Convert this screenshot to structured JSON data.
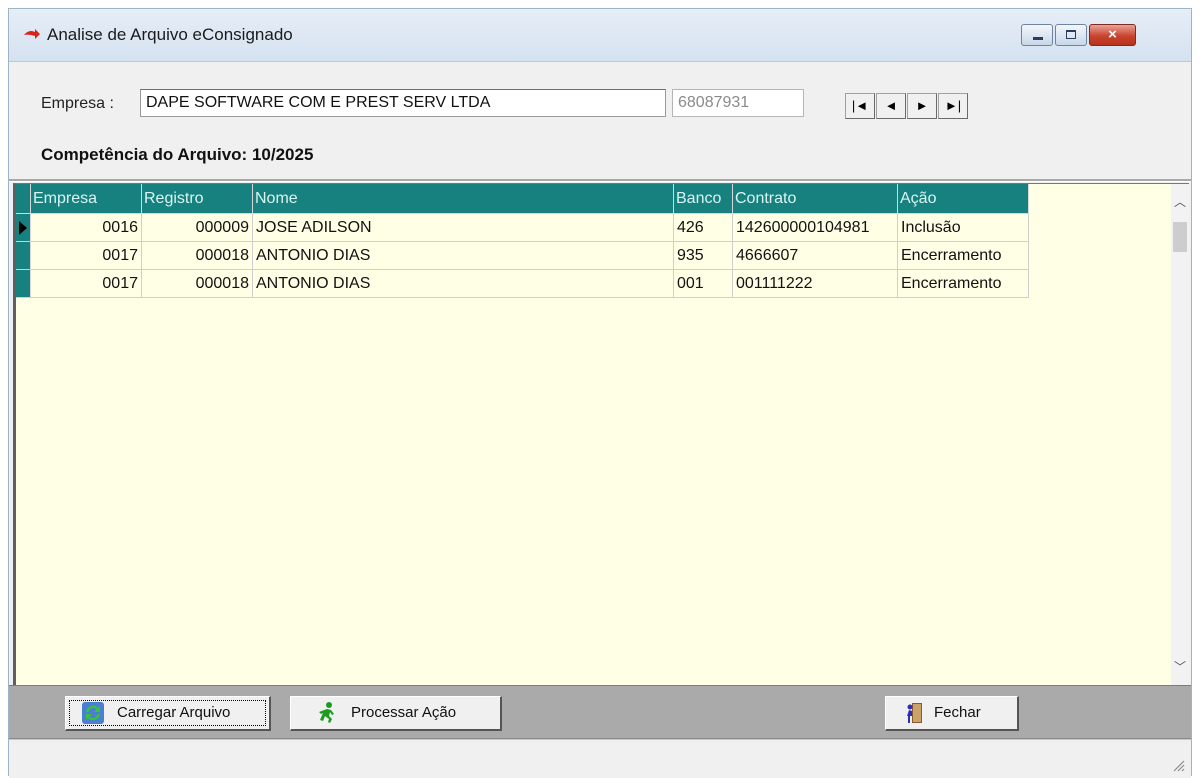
{
  "window": {
    "title": "Analise de Arquivo eConsignado",
    "close_glyph": "×"
  },
  "form": {
    "empresa_label": "Empresa :",
    "empresa_value": "DAPE SOFTWARE COM E PREST SERV LTDA",
    "lookup_button": "...",
    "empresa_code": "68087931",
    "nav_buttons": [
      "|◄",
      "◄",
      "►",
      "►|"
    ],
    "competencia_label": "Competência do Arquivo:",
    "competencia_value": "10/2025"
  },
  "grid": {
    "columns": [
      "Empresa",
      "Registro",
      "Nome",
      "Banco",
      "Contrato",
      "Ação"
    ],
    "rows": [
      [
        "0016",
        "000009",
        "JOSE ADILSON",
        "426",
        "142600000104981",
        "Inclusão"
      ],
      [
        "0017",
        "000018",
        "ANTONIO DIAS",
        "935",
        "4666607",
        "Encerramento"
      ],
      [
        "0017",
        "000018",
        "ANTONIO DIAS",
        "001",
        "001111222",
        "Encerramento"
      ]
    ],
    "current_row": 0,
    "colors": {
      "header_bg": "#17817f",
      "grid_bg": "#ffffe6"
    }
  },
  "toolbar": {
    "load_label": "Carregar Arquivo",
    "process_label": "Processar Ação",
    "close_label": "Fechar"
  },
  "icons": {
    "app": "arrow-icon",
    "load": "refresh-icon",
    "process": "running-man-icon",
    "close": "door-exit-icon"
  }
}
